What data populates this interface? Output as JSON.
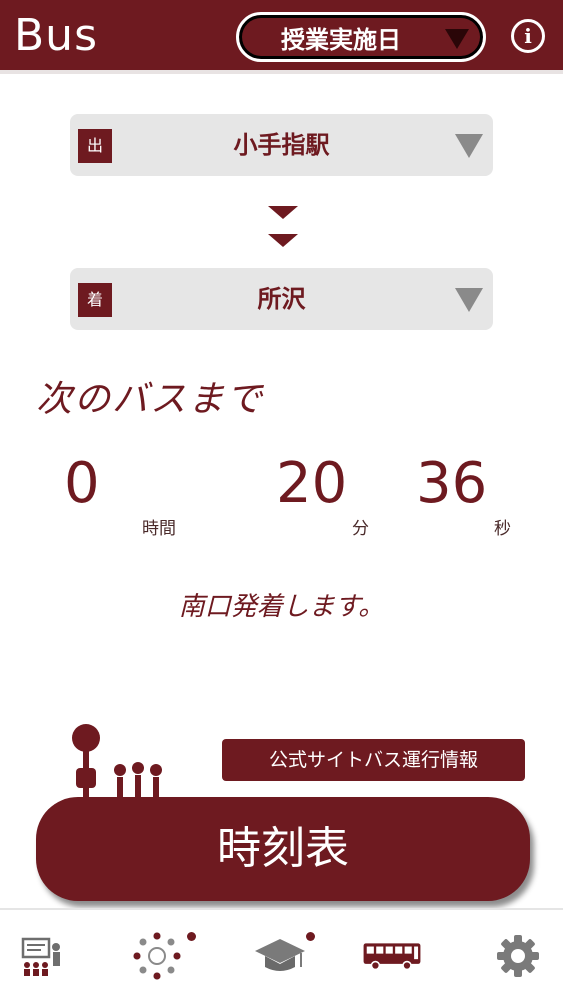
{
  "header": {
    "title": "Bus",
    "day_type": "授業実施日",
    "info_icon": "info-icon"
  },
  "route": {
    "from_tag": "出",
    "from_station": "小手指駅",
    "to_tag": "着",
    "to_station": "所沢"
  },
  "countdown": {
    "label": "次のバスまで",
    "hours": "0",
    "hours_unit": "時間",
    "minutes": "20",
    "minutes_unit": "分",
    "seconds": "36",
    "seconds_unit": "秒",
    "note": "南口発着します。"
  },
  "actions": {
    "official_info": "公式サイトバス運行情報",
    "timetable": "時刻表"
  },
  "tabs": [
    {
      "icon": "lecture-icon",
      "badge": false
    },
    {
      "icon": "community-icon",
      "badge": true
    },
    {
      "icon": "graduation-cap-icon",
      "badge": true
    },
    {
      "icon": "bus-icon",
      "badge": false,
      "active": true
    },
    {
      "icon": "gear-icon",
      "badge": false
    }
  ],
  "colors": {
    "primary": "#6e1a20",
    "field_bg": "#e6e6e6",
    "icon_gray": "#8a8a8a"
  }
}
